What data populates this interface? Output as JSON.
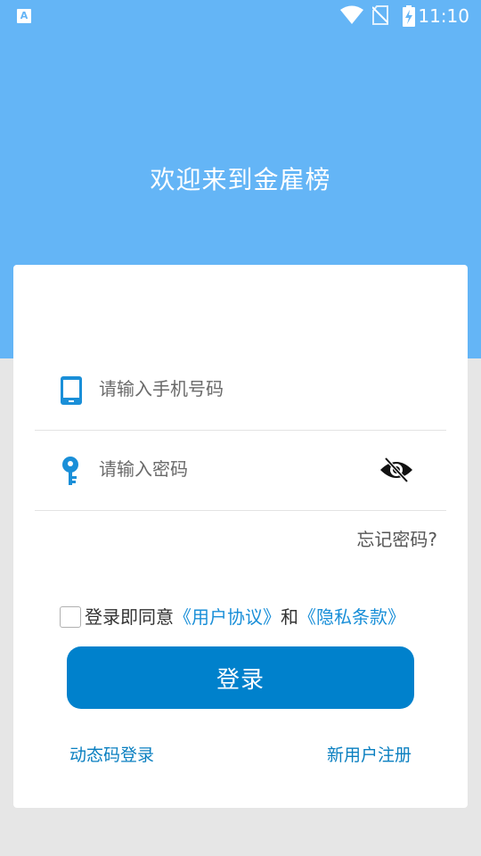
{
  "status_bar": {
    "left_icon": "A",
    "time": "11:10",
    "icons": [
      "wifi-icon",
      "no-sim-icon",
      "battery-charging-icon"
    ]
  },
  "header": {
    "welcome": "欢迎来到金雇榜"
  },
  "form": {
    "phone_placeholder": "请输入手机号码",
    "password_placeholder": "请输入密码",
    "forgot_password": "忘记密码?",
    "agree_prefix": "登录即同意",
    "user_agreement": "《用户协议》",
    "and": "和",
    "privacy_policy": "《隐私条款》",
    "login_button": "登录",
    "dynamic_code_login": "动态码登录",
    "register": "新用户注册"
  },
  "colors": {
    "header": "#64b5f6",
    "primary": "#0081cc",
    "link": "#1a8fd8"
  }
}
